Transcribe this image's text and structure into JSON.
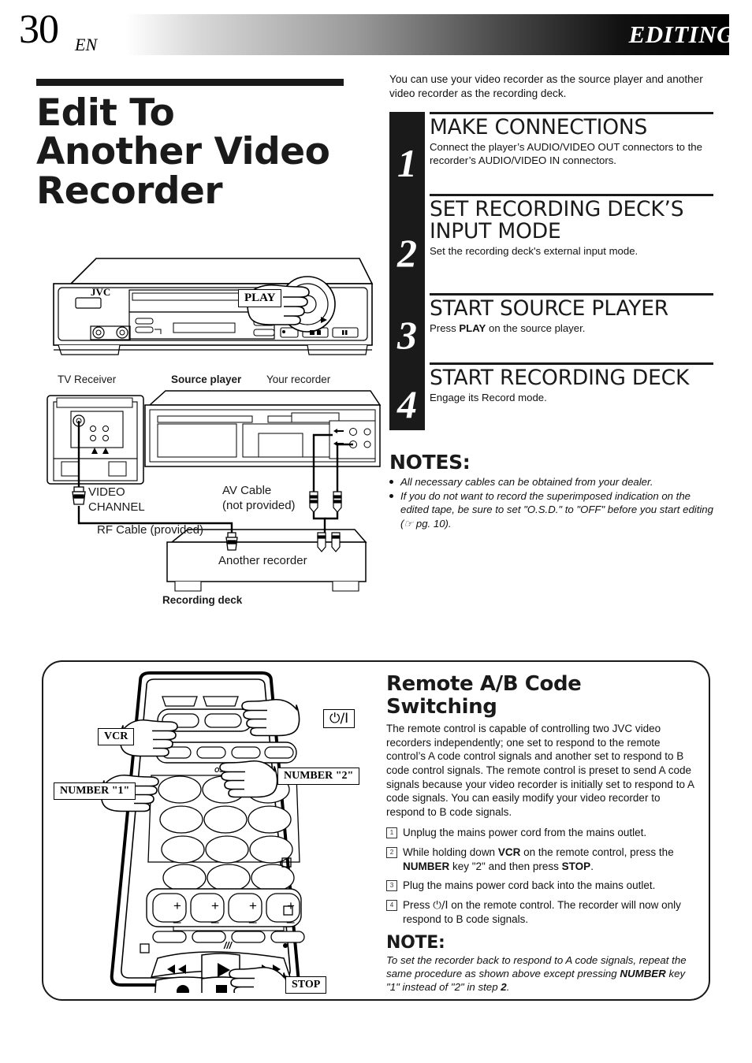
{
  "header": {
    "page_number": "30",
    "language_code": "EN",
    "section_title": "EDITING"
  },
  "left": {
    "title_line1": "Edit To",
    "title_line2": "Another Video",
    "title_line3": "Recorder",
    "vcr_callout": "PLAY",
    "vcr_brand": "JVC",
    "diagram_labels": {
      "tv_receiver": "TV Receiver",
      "source_player": "Source player",
      "your_recorder": "Your recorder",
      "video_channel_line1": "VIDEO",
      "video_channel_line2": "CHANNEL",
      "av_cable_line1": "AV Cable",
      "av_cable_line2": "(not provided)",
      "rf_cable": "RF Cable (provided)",
      "another_recorder": "Another recorder",
      "recording_deck": "Recording deck"
    }
  },
  "right": {
    "intro": "You can use your video recorder as the source player and another video recorder as the recording deck.",
    "steps": [
      {
        "number": "1",
        "heading": "MAKE CONNECTIONS",
        "body": "Connect the player’s AUDIO/VIDEO OUT connectors to the recorder’s AUDIO/VIDEO IN connectors."
      },
      {
        "number": "2",
        "heading": "SET RECORDING DECK’S INPUT MODE",
        "body": "Set the recording deck's external input mode."
      },
      {
        "number": "3",
        "heading": "START SOURCE PLAYER",
        "body_prefix": "Press ",
        "body_bold": "PLAY",
        "body_suffix": " on the source player."
      },
      {
        "number": "4",
        "heading": "START RECORDING DECK",
        "body": "Engage its Record mode."
      }
    ],
    "notes_heading": "NOTES:",
    "notes": [
      "All necessary cables can be obtained from your dealer.",
      "If you do not want to record the superimposed indication on the edited tape, be sure to set \"O.S.D.\" to \"OFF\" before you start editing (☞ pg. 10)."
    ]
  },
  "bottom": {
    "title_line1": "Remote A/B Code",
    "title_line2": "Switching",
    "body": "The remote control is capable of controlling two JVC video recorders independently; one set to respond to the remote control’s A code control signals and another set to respond to B code control signals. The remote control is preset to send A code signals because your video recorder is initially set to respond to A code signals. You can easily modify your video recorder to respond to B code signals.",
    "steps": [
      {
        "number": "1",
        "text": "Unplug the mains power cord from the mains outlet."
      },
      {
        "number": "2",
        "text_1": "While holding down ",
        "bold_1": "VCR",
        "text_2": " on the remote control, press the ",
        "bold_2": "NUMBER",
        "text_3": " key \"2\" and then press ",
        "bold_3": "STOP",
        "text_4": "."
      },
      {
        "number": "3",
        "text": "Plug the mains power cord back into the mains outlet."
      },
      {
        "number": "4",
        "text_1": "Press ",
        "symbol": "⏻/I",
        "text_2": " on the remote control. The recorder will now only respond to B code signals."
      }
    ],
    "note_heading": "NOTE:",
    "note_1": "To set the recorder back to respond to A code signals, repeat the same procedure as shown above except pressing ",
    "note_bold": "NUMBER",
    "note_2": " key \"1\" instead of \"2\" in step ",
    "note_bold2": "2",
    "note_3": ".",
    "callouts": {
      "vcr": "VCR",
      "power": "⏻/I",
      "number1": "NUMBER \"1\"",
      "number2": "NUMBER \"2\"",
      "stop": "STOP"
    }
  },
  "colors": {
    "ink": "#1a1a1a",
    "paper": "#ffffff"
  }
}
